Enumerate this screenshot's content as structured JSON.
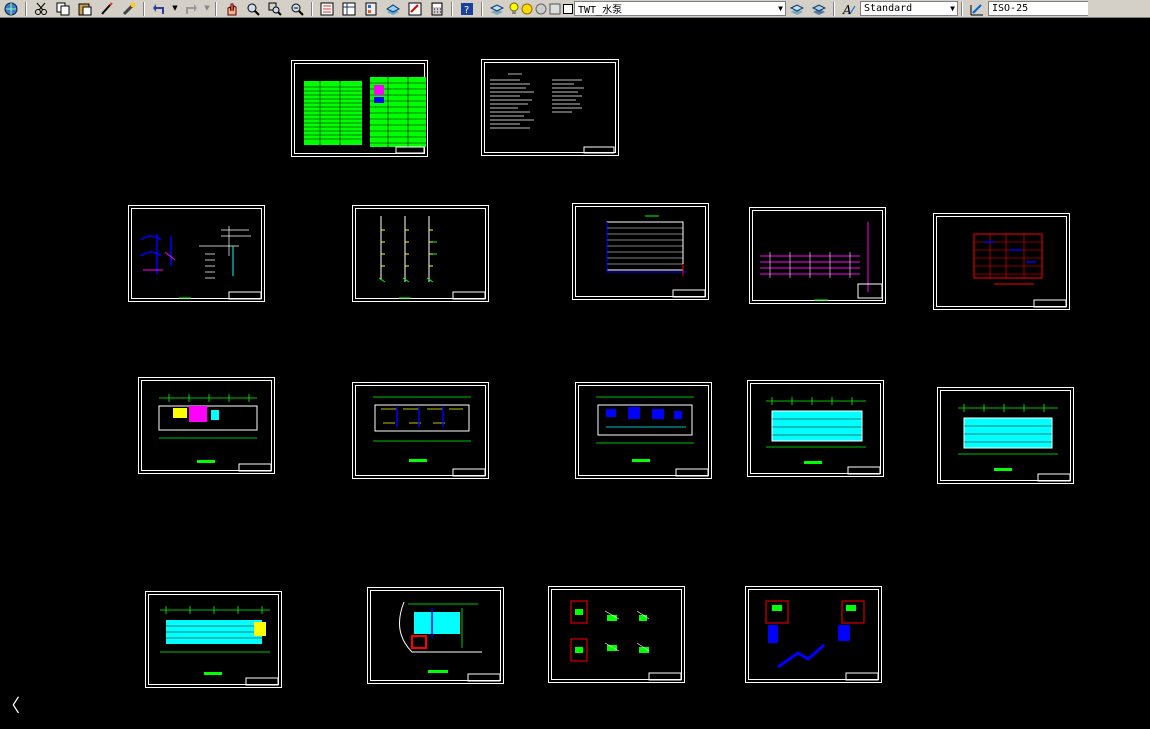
{
  "toolbar": {
    "layer_name": "TWT_水泵",
    "text_style": "Standard",
    "dim_style": "ISO-25",
    "icons": [
      "globe-icon",
      "cut-icon",
      "copy-icon",
      "paste-icon",
      "brush-icon",
      "match-properties-icon",
      "undo-icon",
      "redo-icon",
      "pan-icon",
      "zoom-realtime-icon",
      "zoom-window-icon",
      "zoom-previous-icon",
      "properties-icon",
      "design-center-icon",
      "tool-palettes-icon",
      "sheet-set-icon",
      "markup-icon",
      "calculator-icon",
      "help-icon",
      "layer-manager-icon",
      "bulb-icon",
      "sun-icon",
      "layer-state-icon",
      "color-icon",
      "layer-prev-icon",
      "layer-iso-icon",
      "text-style-icon",
      "dim-style-icon"
    ]
  },
  "colors": {
    "background": "#000000",
    "frame": "#ffffff",
    "green": "#00ff00",
    "cyan": "#00ffff",
    "blue": "#0000ff",
    "magenta": "#ff00ff",
    "red": "#ff0000",
    "yellow": "#ffff00"
  },
  "drawing_sheets": [
    {
      "id": "sheet-01",
      "content": "table-green"
    },
    {
      "id": "sheet-02",
      "content": "text-notes"
    },
    {
      "id": "sheet-03",
      "content": "system-diagram"
    },
    {
      "id": "sheet-04",
      "content": "riser-diagram"
    },
    {
      "id": "sheet-05",
      "content": "pipe-grid"
    },
    {
      "id": "sheet-06",
      "content": "pipe-riser-magenta"
    },
    {
      "id": "sheet-07",
      "content": "red-grid"
    },
    {
      "id": "sheet-08",
      "content": "floor-plan-magenta"
    },
    {
      "id": "sheet-09",
      "content": "floor-plan"
    },
    {
      "id": "sheet-10",
      "content": "floor-plan-blue"
    },
    {
      "id": "sheet-11",
      "content": "floor-plan-cyan"
    },
    {
      "id": "sheet-12",
      "content": "floor-plan-cyan"
    },
    {
      "id": "sheet-13",
      "content": "floor-plan-cyan"
    },
    {
      "id": "sheet-14",
      "content": "site-plan"
    },
    {
      "id": "sheet-15",
      "content": "detail-blocks"
    },
    {
      "id": "sheet-16",
      "content": "detail-blue"
    }
  ],
  "cursor_glyph": "〈"
}
